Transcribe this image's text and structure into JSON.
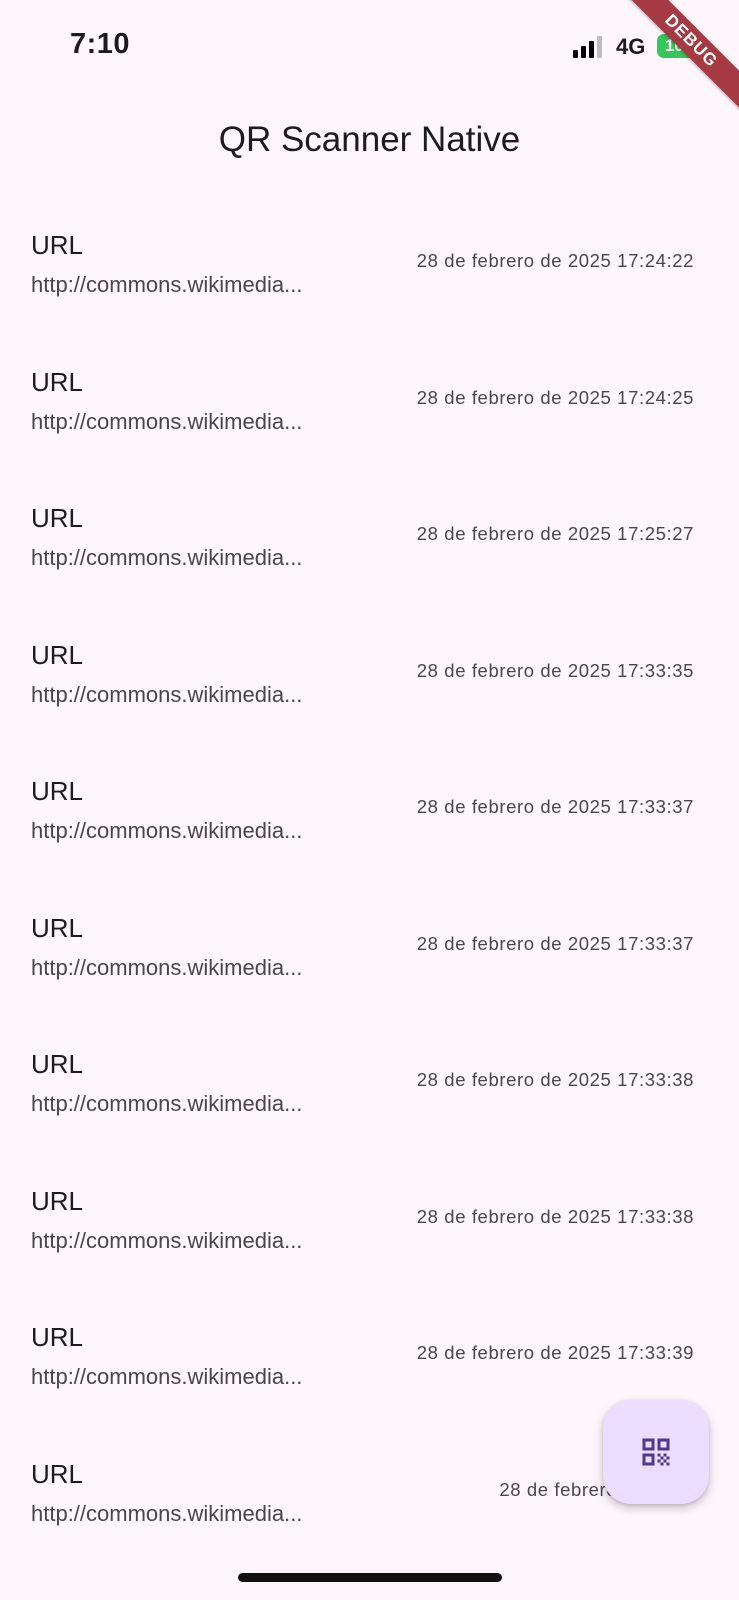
{
  "status_bar": {
    "time": "7:10",
    "network": "4G",
    "battery": "100",
    "signal_icon": "signal-bars-icon"
  },
  "debug_banner": "DEBUG",
  "app_bar": {
    "title": "QR Scanner Native"
  },
  "scans": [
    {
      "type": "URL",
      "value": "http://commons.wikimedia...",
      "date": "28 de febrero de 2025 17:24:22"
    },
    {
      "type": "URL",
      "value": "http://commons.wikimedia...",
      "date": "28 de febrero de 2025 17:24:25"
    },
    {
      "type": "URL",
      "value": "http://commons.wikimedia...",
      "date": "28 de febrero de 2025 17:25:27"
    },
    {
      "type": "URL",
      "value": "http://commons.wikimedia...",
      "date": "28 de febrero de 2025 17:33:35"
    },
    {
      "type": "URL",
      "value": "http://commons.wikimedia...",
      "date": "28 de febrero de 2025 17:33:37"
    },
    {
      "type": "URL",
      "value": "http://commons.wikimedia...",
      "date": "28 de febrero de 2025 17:33:37"
    },
    {
      "type": "URL",
      "value": "http://commons.wikimedia...",
      "date": "28 de febrero de 2025 17:33:38"
    },
    {
      "type": "URL",
      "value": "http://commons.wikimedia...",
      "date": "28 de febrero de 2025 17:33:38"
    },
    {
      "type": "URL",
      "value": "http://commons.wikimedia...",
      "date": "28 de febrero de 2025 17:33:39"
    },
    {
      "type": "URL",
      "value": "http://commons.wikimedia...",
      "date": "28 de febrero de 2025"
    }
  ],
  "fab": {
    "icon": "qr-code-icon"
  },
  "colors": {
    "background": "#fdf7fd",
    "fab_background": "#eaddff",
    "fab_icon": "#4f378b",
    "battery": "#34c759",
    "debug_ribbon": "#a63a43"
  }
}
